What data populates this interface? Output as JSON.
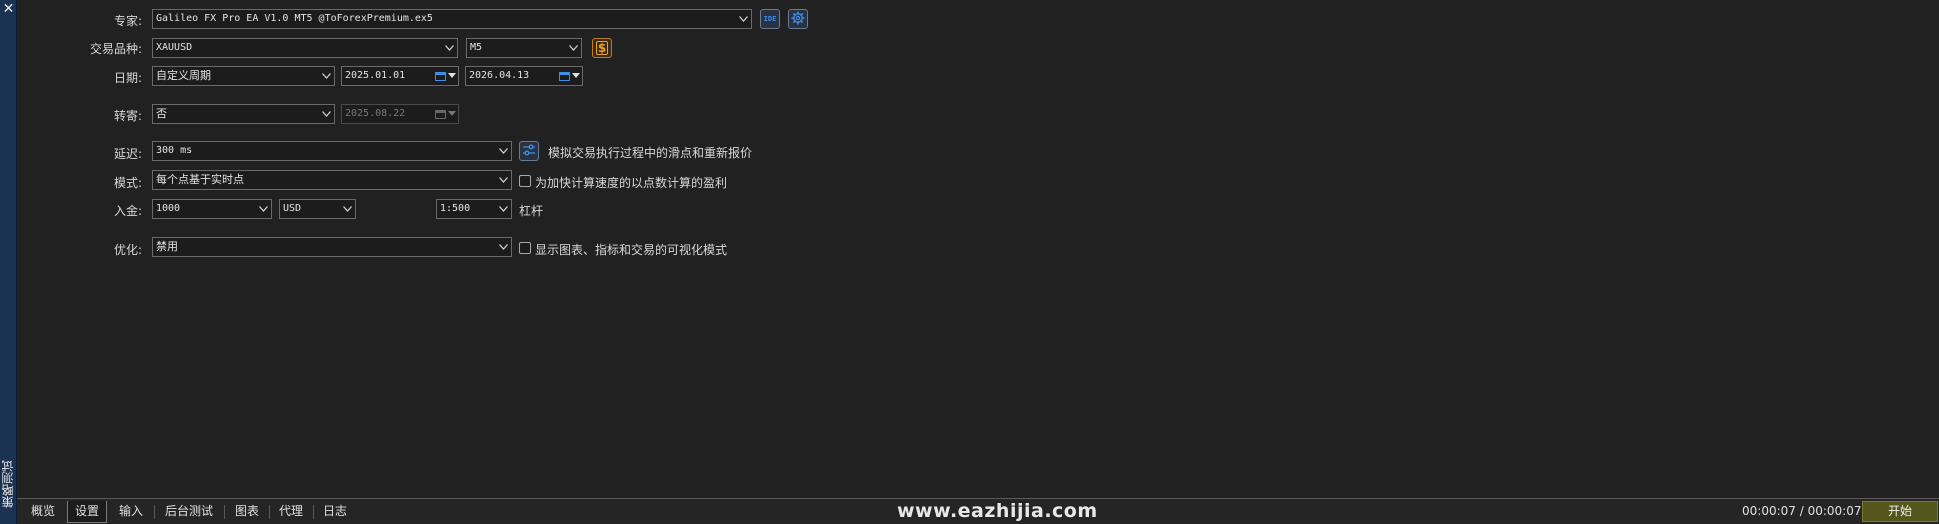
{
  "sidebar": {
    "close_glyph": "✕",
    "title": "策略测试"
  },
  "fields": {
    "expert": {
      "label": "专家:",
      "value": "Galileo FX Pro EA V1.0 MT5 @ToForexPremium.ex5",
      "ide_icon": "IDE",
      "settings_icon": "gear-icon"
    },
    "symbol": {
      "label": "交易品种:",
      "value": "XAUUSD",
      "timeframe": "M5",
      "spec_icon": "$"
    },
    "date": {
      "label": "日期:",
      "period": "自定义周期",
      "from": "2025.01.01",
      "to": "2026.04.13"
    },
    "forward": {
      "label": "转寄:",
      "value": "否",
      "date": "2025.08.22"
    },
    "delay": {
      "label": "延迟:",
      "value": "300 ms",
      "note": "模拟交易执行过程中的滑点和重新报价"
    },
    "mode": {
      "label": "模式:",
      "value": "每个点基于实时点",
      "checkbox_label": "为加快计算速度的以点数计算的盈利"
    },
    "deposit": {
      "label": "入金:",
      "amount": "1000",
      "currency": "USD",
      "leverage": "1:500",
      "leverage_label": "杠杆"
    },
    "optimization": {
      "label": "优化:",
      "value": "禁用",
      "checkbox_label": "显示图表、指标和交易的可视化模式"
    }
  },
  "bottom": {
    "tabs": [
      "概览",
      "设置",
      "输入",
      "后台测试",
      "图表",
      "代理",
      "日志"
    ],
    "active_tab": "设置",
    "watermark": "www.eazhijia.com",
    "timer": "00:00:07 / 00:00:07",
    "start_label": "开始"
  },
  "colors": {
    "background": "#212121",
    "sidebar": "#1b3350",
    "start_button": "#55561b",
    "icon_blue": "#3d8ee8",
    "icon_orange": "#e8a030"
  }
}
